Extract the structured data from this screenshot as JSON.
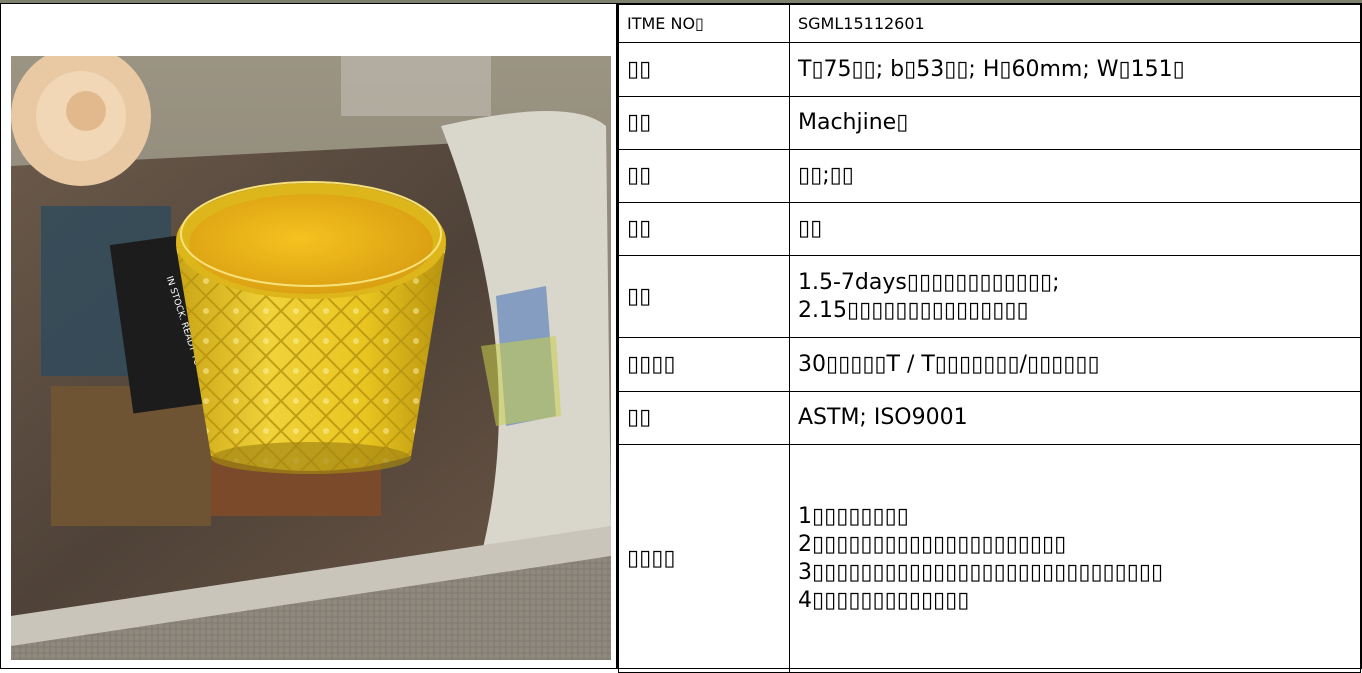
{
  "product": {
    "image_caption_text": "IN STOCK. READY TO SHIP.",
    "accent_color": "#e6c51f"
  },
  "spec_rows": [
    {
      "label": "ITME NO▯",
      "value": "SGML15112601",
      "small": true
    },
    {
      "label": "▯▯",
      "value": "T▯75▯▯; b▯53▯▯; H▯60mm; W▯151▯"
    },
    {
      "label": "▯▯",
      "value": "Machjine▯"
    },
    {
      "label": "▯▯",
      "value": "▯▯;▯▯"
    },
    {
      "label": "▯▯",
      "value": "▯▯"
    },
    {
      "label": "▯▯",
      "value": "1.5-7days▯▯▯▯▯▯▯▯▯▯▯▯;\n2.15▯▯▯▯▯▯▯▯▯▯▯▯▯▯▯"
    },
    {
      "label": "▯▯▯▯",
      "value": "30▯▯▯▯▯T / T▯▯▯▯▯▯▯/▯▯▯▯▯▯"
    },
    {
      "label": "▯▯",
      "value": "ASTM; ISO9001"
    },
    {
      "label": "▯▯▯▯",
      "value": "1▯▯▯▯▯▯▯▯\n2▯▯▯▯▯▯▯▯▯▯▯▯▯▯▯▯▯▯▯▯▯\n3▯▯▯▯▯▯▯▯▯▯▯▯▯▯▯▯▯▯▯▯▯▯▯▯▯▯▯▯▯\n4▯▯▯▯▯▯▯▯▯▯▯▯▯"
    }
  ]
}
